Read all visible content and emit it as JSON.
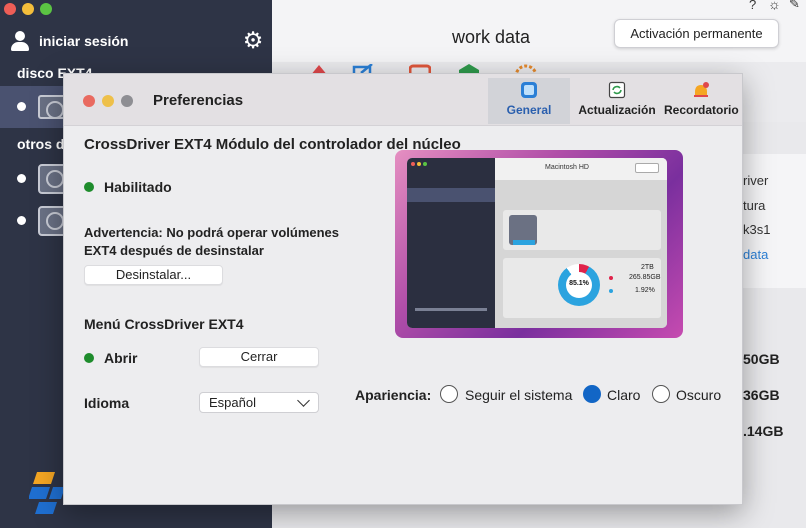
{
  "sidebar": {
    "login_label": "iniciar sesión",
    "section_ext4": "disco EXT4",
    "section_other": "otros d"
  },
  "main": {
    "title": "work data",
    "activation_button": "Activación permanente",
    "bg_texts": [
      "river",
      "tura",
      "k3s1",
      "data"
    ],
    "bg_sizes": [
      "50GB",
      "36GB",
      ".14GB"
    ]
  },
  "preferences": {
    "title": "Preferencias",
    "tabs": [
      {
        "label": "General",
        "icon": "general-icon",
        "active": true
      },
      {
        "label": "Actualización",
        "icon": "update-icon",
        "active": false
      },
      {
        "label": "Recordatorio",
        "icon": "bell-icon",
        "active": false
      }
    ],
    "module_title": "CrossDriver EXT4 Módulo del controlador del núcleo",
    "status_enabled": "Habilitado",
    "warning": "Advertencia: No podrá operar volúmenes EXT4 después de desinstalar",
    "uninstall_button": "Desinstalar...",
    "menu_title": "Menú CrossDriver EXT4",
    "open_label": "Abrir",
    "close_button": "Cerrar",
    "language_label": "Idioma",
    "language_value": "Español",
    "appearance_label": "Apariencia:",
    "appearance_options": [
      {
        "label": "Seguir el sistema",
        "checked": false
      },
      {
        "label": "Claro",
        "checked": true
      },
      {
        "label": "Oscuro",
        "checked": false
      }
    ],
    "preview": {
      "window_title": "Macintosh HD",
      "donut_label": "85.1%",
      "size_label": "2TB",
      "used_label": "265.85GB",
      "pct_label": "1.92%"
    }
  },
  "colors": {
    "sidebar_bg": "#2e3446",
    "accent_blue": "#1266c6",
    "status_green": "#1e8c2c"
  }
}
